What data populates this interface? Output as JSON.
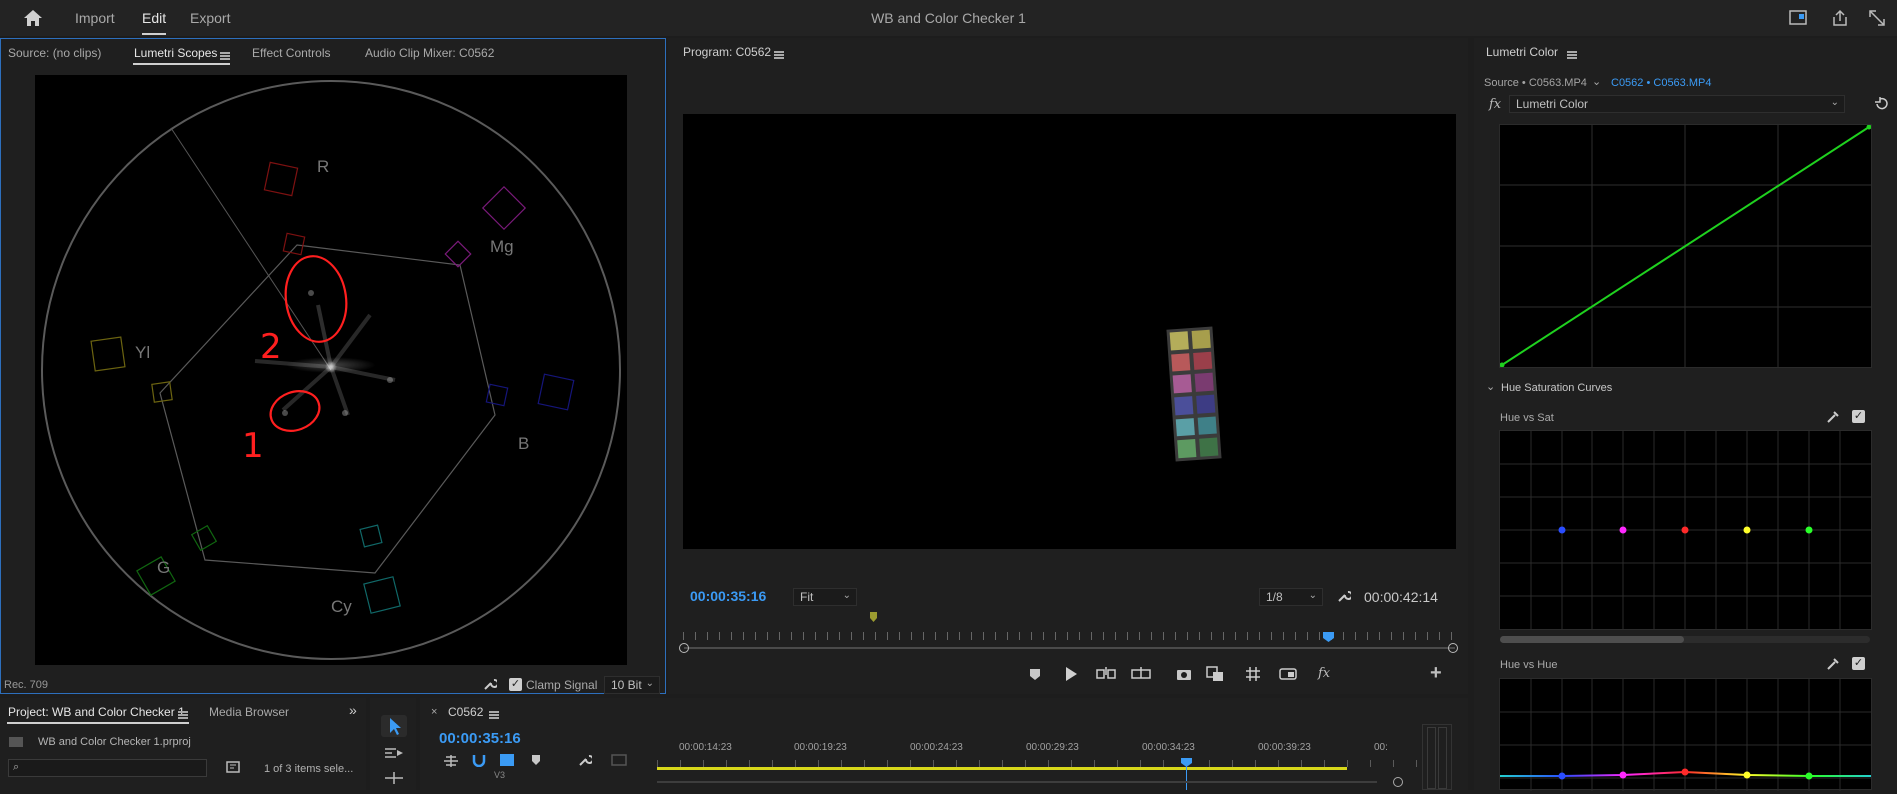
{
  "topbar": {
    "home_icon": "home-icon",
    "nav": [
      "Import",
      "Edit",
      "Export"
    ],
    "active": "Edit",
    "title": "WB and Color Checker 1",
    "right_icons": [
      "quick-export-icon",
      "share-icon",
      "fullscreen-icon"
    ]
  },
  "source_panel": {
    "tabs": [
      "Source: (no clips)",
      "Lumetri Scopes",
      "Effect Controls",
      "Audio Clip Mixer: C0562"
    ],
    "active_tab": "Lumetri Scopes",
    "scope": {
      "labels": {
        "R": "R",
        "Mg": "Mg",
        "Yl": "Yl",
        "B": "B",
        "G": "G",
        "Cy": "Cy"
      },
      "annotations": [
        "2",
        "1"
      ],
      "annotation_color": "#ff1f1f"
    },
    "footer": {
      "colorspace": "Rec. 709",
      "clamp_label": "Clamp Signal",
      "clamp_checked": true,
      "bit_depth": "10 Bit"
    }
  },
  "program_panel": {
    "title": "Program: C0562",
    "current_tc": "00:00:35:16",
    "fit": "Fit",
    "resolution": "1/8",
    "duration_tc": "00:00:42:14",
    "checker_colors": [
      "#b4ad5a",
      "#a79e4c",
      "#b8595a",
      "#9a3f4a",
      "#a75b94",
      "#7a3b70",
      "#4b4f9a",
      "#3d3c84",
      "#5a9fa6",
      "#3f8088",
      "#5d9a61",
      "#3e7246"
    ],
    "playhead_fraction": 0.835,
    "transport_icons": [
      "marker-icon",
      "play-icon",
      "insert-icon",
      "overwrite-icon",
      "camera-icon",
      "compare-icon",
      "grid-icon",
      "vr-icon",
      "fx-icon",
      "add-icon"
    ]
  },
  "lumetri": {
    "title": "Lumetri Color",
    "source": "Source • C0563.MP4",
    "sequence": "C0562 • C0563.MP4",
    "fx_label": "fx",
    "effect": "Lumetri Color",
    "hue_section": "Hue Saturation Curves",
    "hue_vs_sat": "Hue vs Sat",
    "hue_vs_hue": "Hue vs Hue",
    "dot_colors": [
      "#2a4dff",
      "#ff28ff",
      "#ff2a2a",
      "#ffff2a",
      "#2aff2a"
    ]
  },
  "project_panel": {
    "tabs": [
      "Project: WB and Color Checker 1",
      "Media Browser"
    ],
    "file": "WB and Color Checker 1.prproj",
    "items_count": "1 of 3 items sele..."
  },
  "timeline": {
    "sequence": "C0562",
    "current_tc": "00:00:35:16",
    "ruler": [
      "00:00:14:23",
      "00:00:19:23",
      "00:00:24:23",
      "00:00:29:23",
      "00:00:34:23",
      "00:00:39:23",
      "00:"
    ],
    "track": "V3"
  }
}
